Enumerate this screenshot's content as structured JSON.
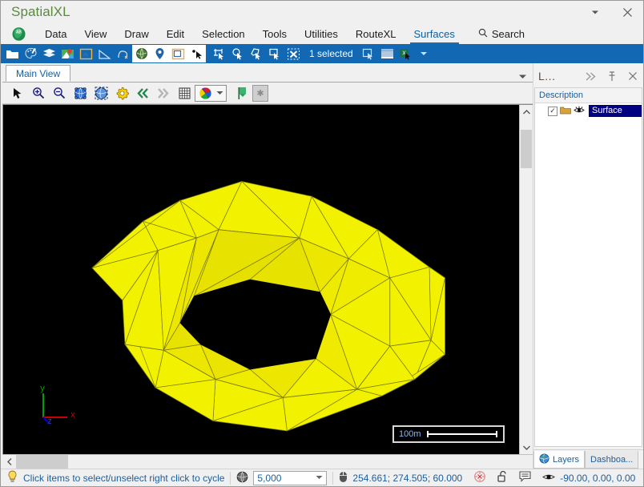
{
  "window": {
    "title": "SpatialXL",
    "minimize_icon": "chevron-down-icon",
    "close_icon": "close-icon"
  },
  "menubar": {
    "logo_icon": "globe-ab-icon",
    "items": [
      {
        "label": "Data",
        "active": false
      },
      {
        "label": "View",
        "active": false
      },
      {
        "label": "Draw",
        "active": false
      },
      {
        "label": "Edit",
        "active": false
      },
      {
        "label": "Selection",
        "active": false
      },
      {
        "label": "Tools",
        "active": false
      },
      {
        "label": "Utilities",
        "active": false
      },
      {
        "label": "RouteXL",
        "active": false
      },
      {
        "label": "Surfaces",
        "active": true
      }
    ],
    "search_label": "Search",
    "search_icon": "search-icon"
  },
  "ribbon": {
    "accent_color": "#1268b3",
    "buttons": [
      {
        "name": "open-folder-icon"
      },
      {
        "name": "palette-tool-icon"
      },
      {
        "name": "layers-stack-icon"
      },
      {
        "name": "map-pin-icon"
      },
      {
        "name": "boundary-icon"
      },
      {
        "name": "measure-angle-icon"
      },
      {
        "name": "polyline-icon"
      },
      {
        "name": "globe-icon"
      },
      {
        "name": "location-pin-icon"
      },
      {
        "name": "label-box-icon"
      },
      {
        "name": "select-point-icon"
      },
      {
        "name": "select-rect-icon"
      },
      {
        "name": "select-circle-icon"
      },
      {
        "name": "select-polygon-icon"
      },
      {
        "name": "select-box-icon"
      },
      {
        "name": "clear-selection-icon"
      }
    ],
    "selection_status": "1 selected",
    "right_buttons": [
      {
        "name": "copy-selection-icon"
      },
      {
        "name": "table-view-icon"
      },
      {
        "name": "export-excel-icon"
      }
    ],
    "overflow_icon": "chevron-down-icon"
  },
  "doctabs": {
    "tabs": [
      {
        "label": "Main View",
        "active": true
      }
    ],
    "overflow_icon": "chevron-down-icon"
  },
  "viewbar": {
    "buttons": [
      {
        "name": "arrow-select-icon"
      },
      {
        "name": "zoom-in-icon"
      },
      {
        "name": "zoom-out-icon"
      },
      {
        "name": "globe-zoom-extent-icon"
      },
      {
        "name": "globe-zoom-selected-icon"
      },
      {
        "name": "settings-gear-icon"
      },
      {
        "name": "previous-view-icon"
      },
      {
        "name": "next-view-icon"
      },
      {
        "name": "grid-icon"
      }
    ],
    "palette_icon": "color-palette-icon",
    "palette_dropdown_icon": "chevron-down-icon",
    "bookmark_icon": "green-flag-icon",
    "star_icon": "star-icon"
  },
  "viewport": {
    "background_color": "#000000",
    "surface_color": "#f2f200",
    "wireframe_color": "#6b6b00",
    "axis": {
      "x_label": "x",
      "x_color": "#cc0000",
      "y_label": "y",
      "y_color": "#00a000",
      "z_label": "z",
      "z_color": "#0000cc"
    },
    "scalebar": {
      "label": "100m",
      "label_color": "#7fb8ff"
    },
    "vscroll_up_icon": "chevron-up-icon",
    "vscroll_down_icon": "chevron-down-icon",
    "hscroll_left_icon": "chevron-left-icon"
  },
  "right_panel": {
    "title": "L...",
    "buttons": [
      {
        "name": "expand-right-icon",
        "glyph": "»"
      },
      {
        "name": "pin-icon",
        "glyph": "⚐"
      },
      {
        "name": "close-icon",
        "glyph": "✕"
      }
    ],
    "column_header": "Description",
    "rows": [
      {
        "checkbox_checked": true,
        "checkbox_glyph": "✓",
        "folder_icon": "folder-icon",
        "visibility_icon": "eye-icon",
        "label": "Surface",
        "selected": true,
        "selected_color": "#000080"
      }
    ],
    "tabs": [
      {
        "label": "Layers",
        "icon": "globe-icon",
        "active": true
      },
      {
        "label": "Dashboa...",
        "icon": "",
        "active": false
      }
    ]
  },
  "statusbar": {
    "hint_icon": "lightbulb-icon",
    "hint_text": "Click items to select/unselect right click to cycle",
    "scale_icon": "globe-icon",
    "scale_value": "5,000",
    "scale_caret": "▾",
    "coords_icon": "mouse-icon",
    "coords_text": "254.661; 274.505; 60.000",
    "target_icon": "crosshair-icon",
    "lock_icon": "unlocked-padlock-icon",
    "note_icon": "note-icon",
    "view_icon": "eye-icon",
    "view_angles": "-90.00, 0.00, 0.00"
  }
}
